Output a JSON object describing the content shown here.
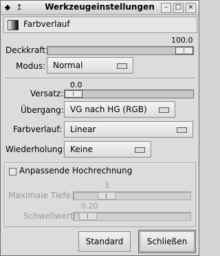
{
  "window": {
    "title": "Werkzeugeinstellungen"
  },
  "header": {
    "label": "Farbverlauf"
  },
  "opacity": {
    "label": "Deckkraft:",
    "value": "100.0",
    "level": 1.0
  },
  "mode": {
    "label": "Modus:",
    "selected": "Normal"
  },
  "offset": {
    "label": "Versatz:",
    "value": "0.0",
    "level": 0.0
  },
  "gradient": {
    "label": "Übergang:",
    "selected": "VG nach HG (RGB)"
  },
  "shape": {
    "label": "Farbverlauf:",
    "selected": "Linear"
  },
  "repeat": {
    "label": "Wiederholung:",
    "selected": "Keine"
  },
  "supersample": {
    "label": "Anpassende Hochrechnung",
    "checked": false,
    "max_depth": {
      "label": "Maximale Tiefe:",
      "value": "3",
      "level": 0.16
    },
    "threshold": {
      "label": "Schwellwert:",
      "value": "0.20",
      "level": 0.04
    }
  },
  "buttons": {
    "reset": "Standard",
    "close": "Schließen"
  }
}
